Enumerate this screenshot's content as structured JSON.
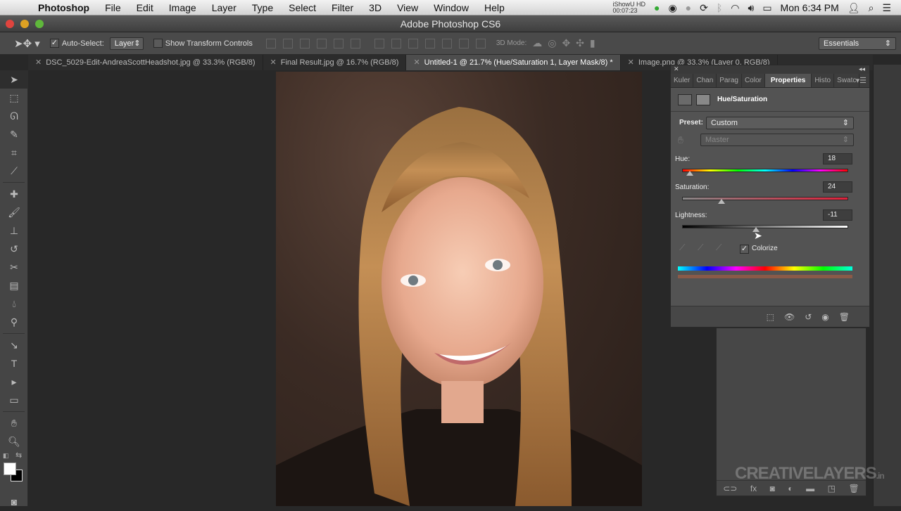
{
  "menubar": {
    "app": "Photoshop",
    "items": [
      "File",
      "Edit",
      "Image",
      "Layer",
      "Type",
      "Select",
      "Filter",
      "3D",
      "View",
      "Window",
      "Help"
    ],
    "recorder_name": "iShowU HD",
    "recorder_time": "00:07:23",
    "clock": "Mon 6:34 PM"
  },
  "window": {
    "title": "Adobe Photoshop CS6"
  },
  "options": {
    "auto_select_label": "Auto-Select:",
    "auto_select_checked": true,
    "auto_select_value": "Layer",
    "show_transform_label": "Show Transform Controls",
    "mode_3d_label": "3D Mode:",
    "workspace": "Essentials"
  },
  "doc_tabs": [
    {
      "label": "DSC_5029-Edit-AndreaScottHeadshot.jpg @ 33.3% (RGB/8)",
      "active": false
    },
    {
      "label": "Final Result.jpg @ 16.7% (RGB/8)",
      "active": false
    },
    {
      "label": "Untitled-1 @ 21.7% (Hue/Saturation 1, Layer Mask/8) *",
      "active": true
    },
    {
      "label": "Image.png @ 33.3% (Layer 0, RGB/8)",
      "active": false
    }
  ],
  "tools": [
    "move",
    "marquee",
    "lasso",
    "quick-select",
    "crop",
    "eyedropper",
    "healing",
    "brush",
    "clone-stamp",
    "history-brush",
    "eraser",
    "gradient",
    "blur",
    "dodge",
    "path-select",
    "type",
    "direct-select",
    "shape",
    "hand",
    "zoom"
  ],
  "panel": {
    "tabs": [
      "Kuler",
      "Chan",
      "Parag",
      "Color",
      "Properties",
      "Histo",
      "Swatc"
    ],
    "active_tab": "Properties",
    "title": "Hue/Saturation",
    "preset_label": "Preset:",
    "preset_value": "Custom",
    "channel_value": "Master",
    "hue_label": "Hue:",
    "hue_value": "18",
    "saturation_label": "Saturation:",
    "saturation_value": "24",
    "lightness_label": "Lightness:",
    "lightness_value": "-11",
    "colorize_label": "Colorize",
    "colorize_checked": true,
    "colorize_swatch": "#8a5a48"
  },
  "watermark": {
    "main": "CREATIVELAYERS",
    "suffix": ".in"
  }
}
